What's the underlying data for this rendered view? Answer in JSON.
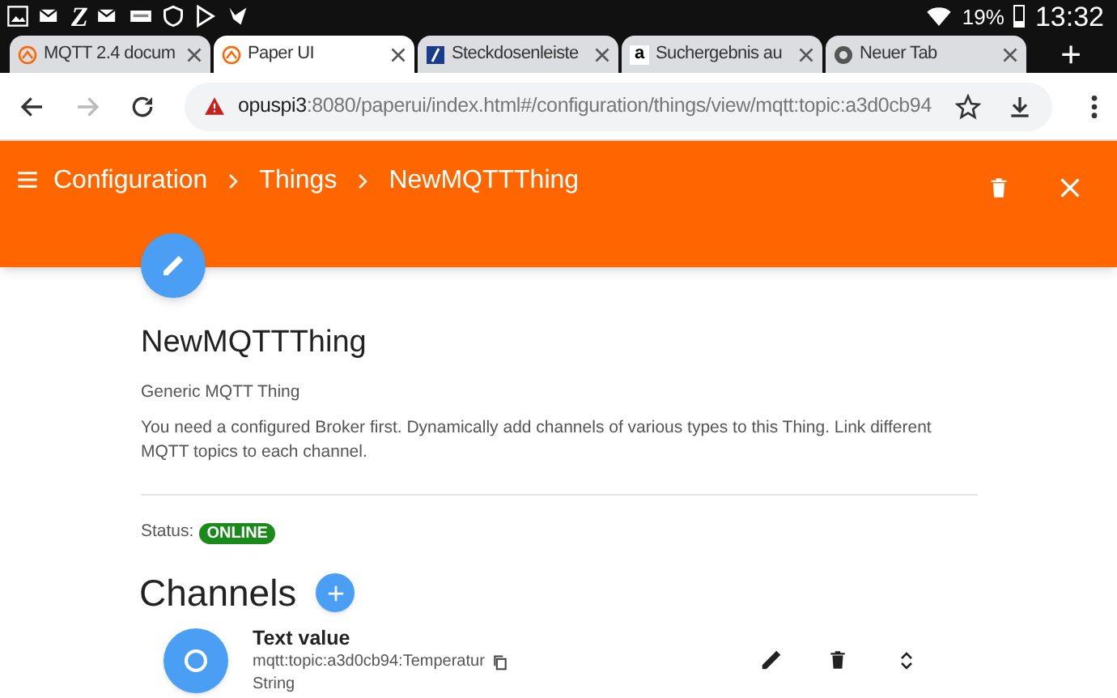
{
  "status_bar": {
    "app_letter": "Z",
    "battery": "19%",
    "time": "13:32"
  },
  "tabs": [
    {
      "title": "MQTT 2.4 docum",
      "kind": "paper",
      "selected": false
    },
    {
      "title": "Paper UI",
      "kind": "paper",
      "selected": true
    },
    {
      "title": "Steckdosenleiste",
      "kind": "square",
      "selected": false
    },
    {
      "title": "Suchergebnis au",
      "kind": "letter",
      "favicon_text": "a",
      "selected": false
    },
    {
      "title": "Neuer Tab",
      "kind": "chrome",
      "selected": false
    }
  ],
  "new_tab": "+",
  "address_bar": {
    "host": "opuspi3",
    "path": ":8080/paperui/index.html#/configuration/things/view/mqtt:topic:a3d0cb94"
  },
  "breadcrumb": [
    "Configuration",
    "Things",
    "NewMQTTThing"
  ],
  "thing": {
    "title": "NewMQTTThing",
    "type": "Generic MQTT Thing",
    "description": "You need a configured Broker first. Dynamically add channels of various types to this Thing. Link different MQTT topics to each channel.",
    "status_label": "Status:",
    "status": "ONLINE"
  },
  "channels_heading": "Channels",
  "channels": [
    {
      "name": "Text value",
      "uid": "mqtt:topic:a3d0cb94:Temperatur",
      "item_type": "String"
    }
  ]
}
